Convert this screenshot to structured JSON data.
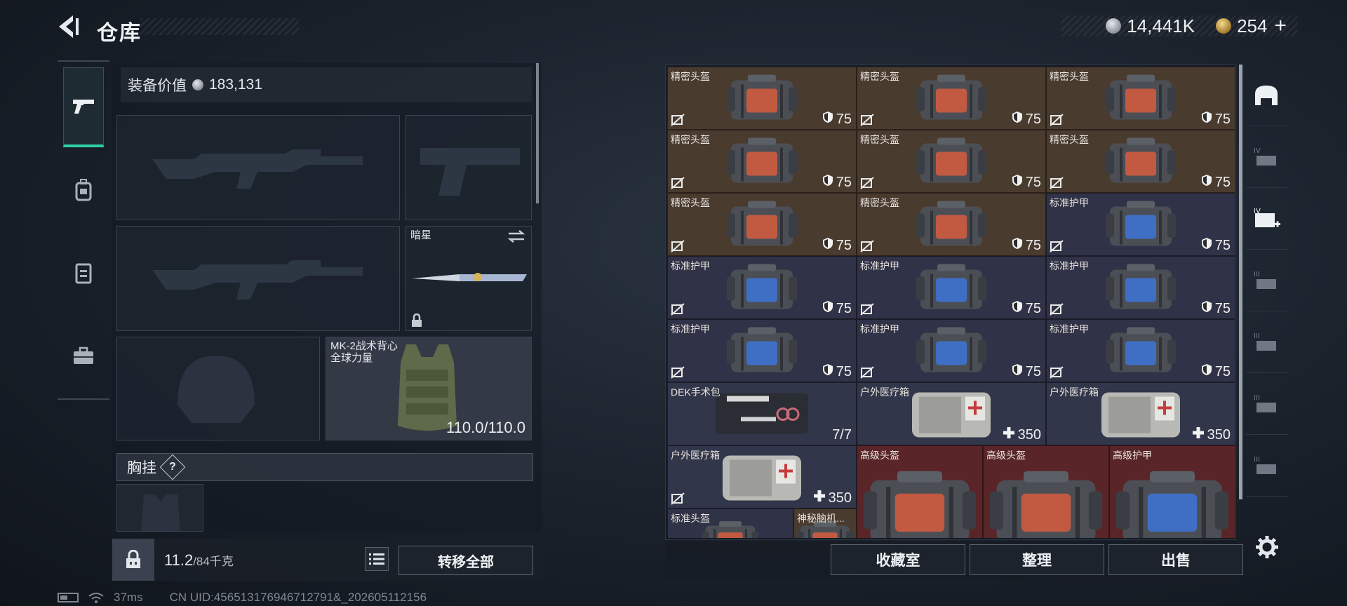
{
  "header": {
    "title": "仓库",
    "currency_silver": "14,441K",
    "currency_gold": "254",
    "gold_plus": "+"
  },
  "nav": {
    "tabs": [
      {
        "icon": "pistol-icon",
        "active": true
      },
      {
        "icon": "backpack-icon",
        "active": false
      },
      {
        "icon": "vest-icon",
        "active": false
      },
      {
        "icon": "briefcase-icon",
        "active": false
      }
    ]
  },
  "loadout": {
    "equip_value_label": "装备价值",
    "equip_value": "183,131",
    "knife_name": "暗星",
    "vest_name": "MK-2战术背心",
    "vest_sub": "全球力量",
    "vest_durability": "110.0/110.0",
    "chest_rig_label": "胸挂",
    "help": "?"
  },
  "weight": {
    "current": "11.2",
    "max": "/84千克"
  },
  "buttons": {
    "transfer_all": "转移全部",
    "collection": "收藏室",
    "organize": "整理",
    "sell": "出售"
  },
  "inventory": {
    "rows": [
      [
        {
          "name": "精密头盔",
          "type": "helmet",
          "stat": "75"
        },
        {
          "name": "精密头盔",
          "type": "helmet",
          "stat": "75"
        },
        {
          "name": "精密头盔",
          "type": "helmet",
          "stat": "75"
        }
      ],
      [
        {
          "name": "精密头盔",
          "type": "helmet",
          "stat": "75"
        },
        {
          "name": "精密头盔",
          "type": "helmet",
          "stat": "75"
        },
        {
          "name": "精密头盔",
          "type": "helmet",
          "stat": "75"
        }
      ],
      [
        {
          "name": "精密头盔",
          "type": "helmet",
          "stat": "75"
        },
        {
          "name": "精密头盔",
          "type": "helmet",
          "stat": "75"
        },
        {
          "name": "标准护甲",
          "type": "armor",
          "stat": "75"
        }
      ],
      [
        {
          "name": "标准护甲",
          "type": "armor",
          "stat": "75"
        },
        {
          "name": "标准护甲",
          "type": "armor",
          "stat": "75"
        },
        {
          "name": "标准护甲",
          "type": "armor",
          "stat": "75"
        }
      ],
      [
        {
          "name": "标准护甲",
          "type": "armor",
          "stat": "75"
        },
        {
          "name": "标准护甲",
          "type": "armor",
          "stat": "75"
        },
        {
          "name": "标准护甲",
          "type": "armor",
          "stat": "75"
        }
      ],
      [
        {
          "name": "DEK手术包",
          "type": "surgery",
          "stat": "7/7"
        },
        {
          "name": "户外医疗箱",
          "type": "medkit",
          "stat": "350"
        },
        {
          "name": "户外医疗箱",
          "type": "medkit",
          "stat": "350"
        }
      ],
      [
        {
          "name": "户外医疗箱",
          "type": "medkit",
          "stat": "350"
        }
      ]
    ],
    "big_items": [
      {
        "name": "高级头盔",
        "type": "red-helmet"
      },
      {
        "name": "高级头盔",
        "type": "red-helmet"
      },
      {
        "name": "高级护甲",
        "type": "red-armor"
      }
    ],
    "partial_items": [
      {
        "name": "标准头盔"
      },
      {
        "name": "神秘脑机..."
      }
    ]
  },
  "side_tabs": [
    "iv-helmet-icon",
    "iv-folder-icon",
    "iv-medkit-add-icon",
    "iii-gun-icon",
    "iii-gun2-icon",
    "iii-tent-icon",
    "iii-tool-icon"
  ],
  "status": {
    "ping": "37ms",
    "uid": "CN UID:456513176946712791&_202605112156"
  },
  "colors": {
    "accent": "#2fcfa6",
    "helmet_bg": "#4a3b2f",
    "armor_bg": "#303247",
    "red_bg": "#5a2528"
  }
}
